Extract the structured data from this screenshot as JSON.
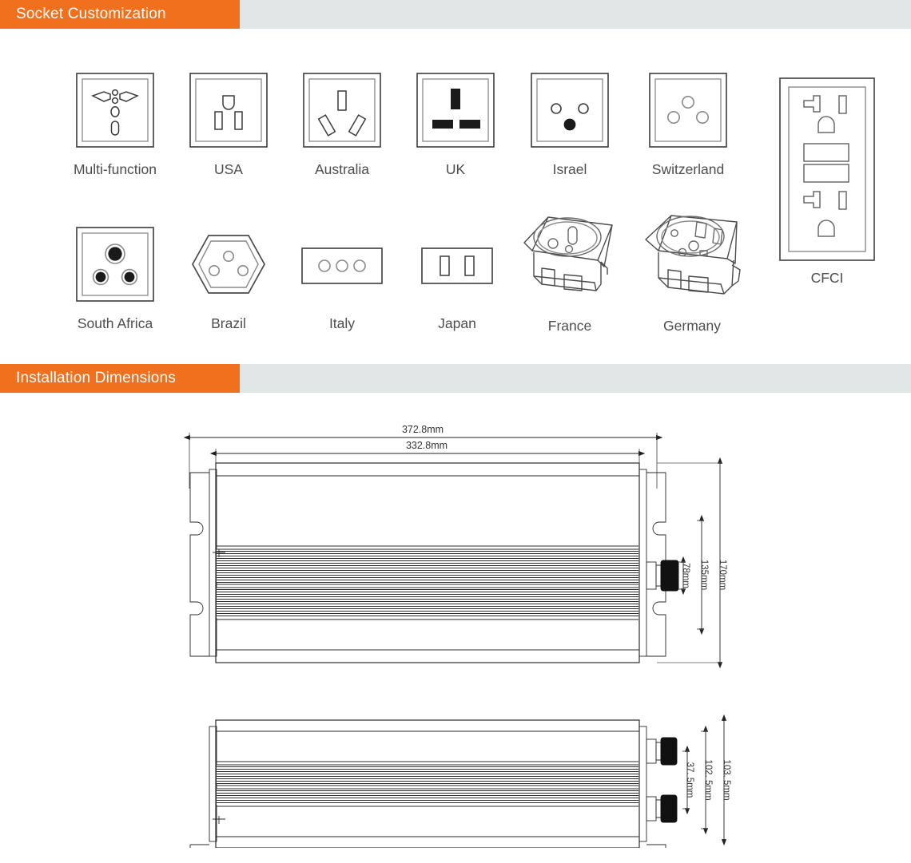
{
  "sections": [
    {
      "id": "socket-customization",
      "title": "Socket Customization"
    },
    {
      "id": "installation-dimensions",
      "title": "Installation Dimensions"
    }
  ],
  "colors": {
    "accent_orange": "#f1701d",
    "header_bar_gray": "#e3e6e7",
    "label_text": "#4d4d4d",
    "line_art": "#3c3c3c",
    "page_background": "#ffffff"
  },
  "sockets": {
    "row1": [
      {
        "label": "Multi-function",
        "icon": "socket-multifunction-icon"
      },
      {
        "label": "USA",
        "icon": "socket-usa-icon"
      },
      {
        "label": "Australia",
        "icon": "socket-australia-icon"
      },
      {
        "label": "UK",
        "icon": "socket-uk-icon"
      },
      {
        "label": "Israel",
        "icon": "socket-israel-icon"
      },
      {
        "label": "Switzerland",
        "icon": "socket-switzerland-icon"
      }
    ],
    "row2": [
      {
        "label": "South Africa",
        "icon": "socket-south-africa-icon"
      },
      {
        "label": "Brazil",
        "icon": "socket-brazil-icon"
      },
      {
        "label": "Italy",
        "icon": "socket-italy-icon"
      },
      {
        "label": "Japan",
        "icon": "socket-japan-icon"
      },
      {
        "label": "France",
        "icon": "socket-france-icon"
      },
      {
        "label": "Germany",
        "icon": "socket-germany-icon"
      }
    ],
    "tall": {
      "label": "CFCI",
      "icon": "socket-cfci-icon"
    }
  },
  "dimensions": {
    "top_view": {
      "overall_length": "372.8mm",
      "body_length": "332.8mm",
      "terminal_height": "78mm",
      "body_height": "135mm",
      "overall_height": "170mm"
    },
    "side_view": {
      "terminal_spacing": "37. 5mm",
      "body_depth": "102. 5mm",
      "overall_depth": "103. 5mm"
    }
  }
}
